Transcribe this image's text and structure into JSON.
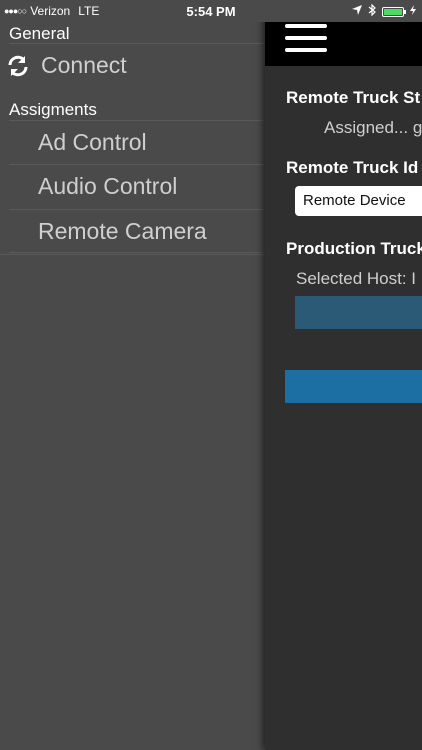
{
  "status_bar": {
    "signal_dots": "●●●○○",
    "carrier": "Verizon",
    "network": "LTE",
    "time": "5:54 PM",
    "location_icon": "location-arrow-icon",
    "bluetooth_icon": "bluetooth-icon",
    "battery_icon": "battery-icon",
    "charging_icon": "charging-bolt-icon",
    "battery_color": "#4cd964"
  },
  "drawer": {
    "general_header": "General",
    "connect_label": "Connect",
    "assignments_header": "Assigments",
    "items": [
      {
        "label": "Ad Control"
      },
      {
        "label": "Audio Control"
      },
      {
        "label": "Remote Camera"
      }
    ]
  },
  "main": {
    "remote_truck_status_heading": "Remote Truck St",
    "assigned_text": "Assigned... ",
    "assigned_link": "g",
    "remote_truck_id_heading": "Remote Truck Id",
    "device_select_value": "Remote Device",
    "production_truck_heading": "Production Truck",
    "selected_host_label": "Selected Host:  I",
    "accent_color": "#1c6fa3"
  }
}
